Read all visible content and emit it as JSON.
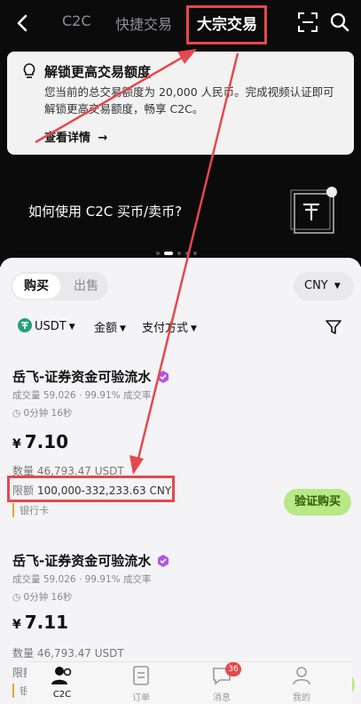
{
  "nav": {
    "tabs": [
      "C2C",
      "快捷交易",
      "大宗交易"
    ],
    "active_tab": "大宗交易"
  },
  "notice": {
    "title": "解锁更高交易额度",
    "body": "您当前的总交易额度为 20,000 人民币。完成视频认证即可解锁更高交易额度，畅享 C2C。",
    "link": "查看详情"
  },
  "promo": {
    "text": "如何使用 C2C 买币/卖币?"
  },
  "trade_toggle": {
    "buy": "购买",
    "sell": "出售"
  },
  "currency": {
    "selected": "CNY"
  },
  "filters": {
    "asset": "USDT",
    "amount": "金额",
    "payment": "支付方式"
  },
  "listings": [
    {
      "merchant": "岳飞-证券资金可验流水",
      "stats": "成交量 59,026 · 99.91% 成交率",
      "time": "0分钟 16秒",
      "currency_symbol": "¥",
      "price": "7.10",
      "qty_label": "数量",
      "qty": "46,793.47 USDT",
      "limit_label": "限额",
      "limit": "100,000-332,233.63 CNY",
      "payment": "银行卡",
      "button": "验证购买"
    },
    {
      "merchant": "岳飞-证券资金可验流水",
      "stats": "成交量 59,026 · 99.91% 成交率",
      "time": "0分钟 16秒",
      "currency_symbol": "¥",
      "price": "7.11",
      "qty_label": "数量",
      "qty": "46,793.47 USDT",
      "limit_label": "限额",
      "payment": "银"
    }
  ],
  "bottom_nav": {
    "items": [
      "C2C",
      "订单",
      "消息",
      "我的"
    ],
    "message_count": "36"
  },
  "colors": {
    "highlight": "#e5484d",
    "buy_button": "#b8e986",
    "dark_bg": "#0b0b0b"
  }
}
